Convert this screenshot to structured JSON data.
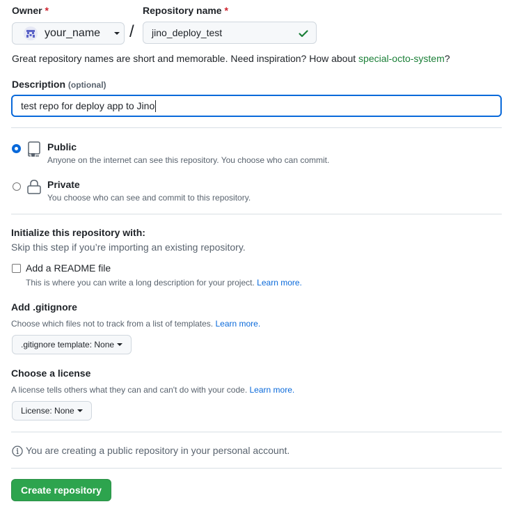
{
  "owner": {
    "label": "Owner",
    "required_mark": "*",
    "selected": "your_name",
    "avatar_icon": "identicon-avatar",
    "dropdown_icon": "caret-down-icon"
  },
  "separator": "/",
  "repo_name": {
    "label": "Repository name",
    "required_mark": "*",
    "value": "jino_deploy_test",
    "valid_icon": "check-icon",
    "valid_color": "#1a7f37"
  },
  "name_hint": {
    "text": "Great repository names are short and memorable. Need inspiration? How about ",
    "suggestion": "special-octo-system",
    "suffix": "?"
  },
  "description": {
    "label": "Description",
    "optional_tag": "(optional)",
    "value": "test repo for deploy app to Jino",
    "focus_color": "#0969da"
  },
  "visibility": {
    "options": [
      {
        "id": "public",
        "title": "Public",
        "description": "Anyone on the internet can see this repository. You choose who can commit.",
        "icon": "repo-book-icon",
        "selected": true
      },
      {
        "id": "private",
        "title": "Private",
        "description": "You choose who can see and commit to this repository.",
        "icon": "lock-icon",
        "selected": false
      }
    ]
  },
  "initialize": {
    "heading": "Initialize this repository with:",
    "subtext": "Skip this step if you’re importing an existing repository.",
    "readme": {
      "label": "Add a README file",
      "checked": false,
      "description": "This is where you can write a long description for your project.",
      "learn_more": "Learn more."
    }
  },
  "gitignore": {
    "heading": "Add .gitignore",
    "description": "Choose which files not to track from a list of templates.",
    "learn_more": "Learn more.",
    "select_label": ".gitignore template: None"
  },
  "license": {
    "heading": "Choose a license",
    "description": "A license tells others what they can and can't do with your code.",
    "learn_more": "Learn more.",
    "select_label": "License: None"
  },
  "notice": {
    "icon": "info-icon",
    "text": "You are creating a public repository in your personal account."
  },
  "submit": {
    "label": "Create repository",
    "color": "#2da44e"
  }
}
